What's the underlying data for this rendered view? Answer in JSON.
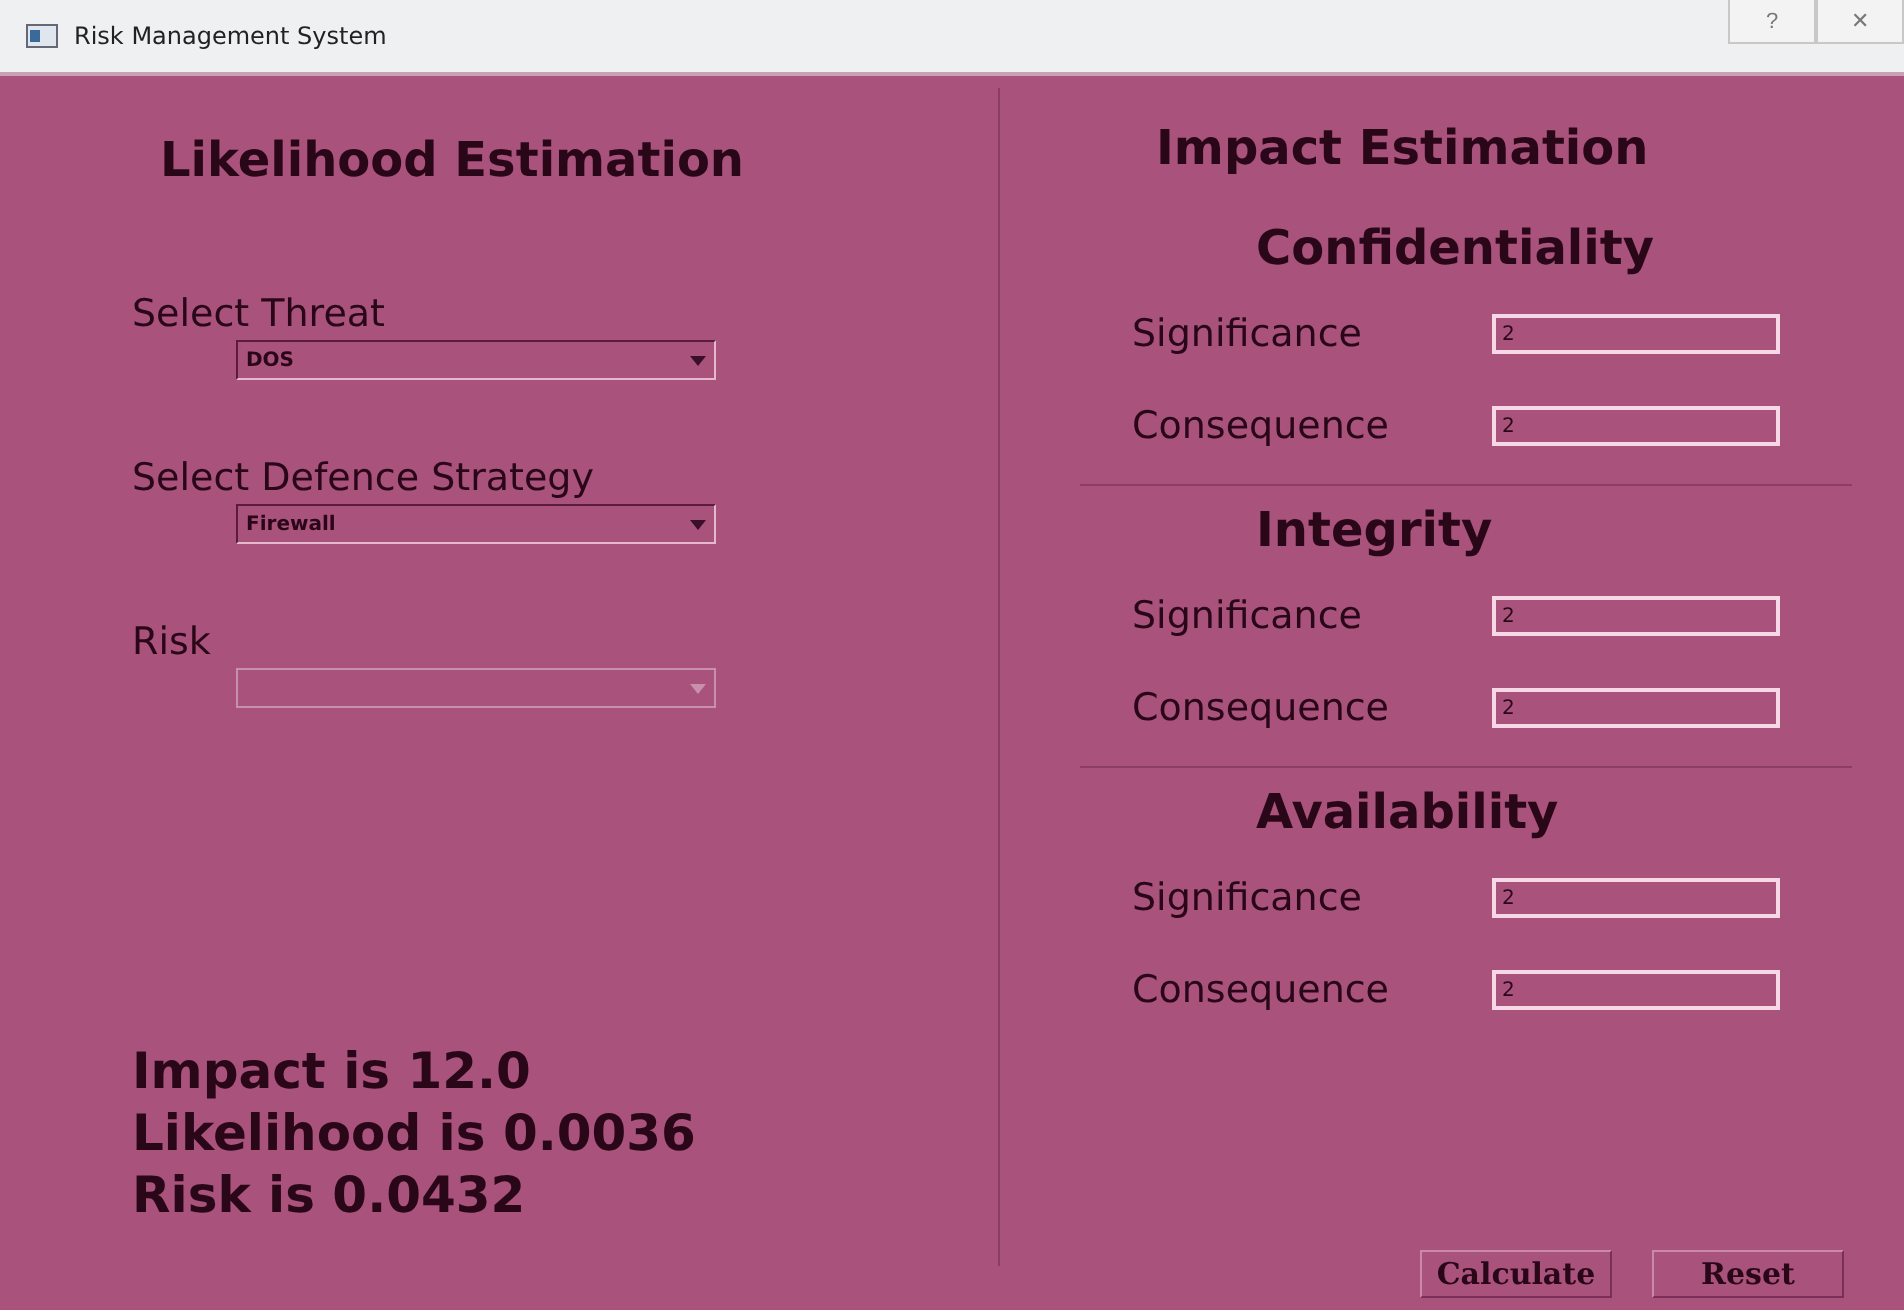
{
  "window": {
    "title": "Risk Management System",
    "buttons": [
      "?",
      "✕"
    ]
  },
  "likelihood": {
    "title": "Likelihood Estimation",
    "selects": [
      {
        "label": "Select Threat",
        "value": "DOS",
        "disabled": false
      },
      {
        "label": "Select Defence Strategy",
        "value": "Firewall",
        "disabled": false
      },
      {
        "label": "Risk",
        "disabled": true
      }
    ],
    "results": [
      "Impact is 12.0",
      "Likelihood is 0.0036",
      "Risk is 0.0432"
    ]
  },
  "impact": {
    "title": "Impact Estimation",
    "sections": [
      {
        "title": "Confidentiality",
        "fields": [
          {
            "label": "Significance",
            "value": "2"
          },
          {
            "label": "Consequence",
            "value": "2"
          }
        ]
      },
      {
        "title": "Integrity",
        "fields": [
          {
            "label": "Significance",
            "value": "2"
          },
          {
            "label": "Consequence",
            "value": "2"
          }
        ]
      },
      {
        "title": "Availability",
        "fields": [
          {
            "label": "Significance",
            "value": "2"
          },
          {
            "label": "Consequence",
            "value": "2"
          }
        ]
      }
    ]
  },
  "buttons": [
    "Calculate",
    "Reset"
  ]
}
